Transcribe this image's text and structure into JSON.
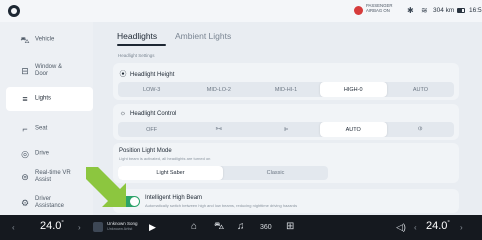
{
  "status": {
    "airbag_line1": "PASSENGER",
    "airbag_line2": "AIRBAG ON",
    "bluetooth_icon": "bluetooth-icon",
    "wifi_icon": "wifi-icon",
    "range": "304 km",
    "time": "16:53"
  },
  "sidebar": {
    "items": [
      {
        "label": "Vehicle",
        "icon": "car-icon"
      },
      {
        "label": "Window & Door",
        "icon": "door-icon"
      },
      {
        "label": "Lights",
        "icon": "lights-icon",
        "active": true
      },
      {
        "label": "Seat",
        "icon": "seat-icon"
      },
      {
        "label": "Drive",
        "icon": "steering-icon"
      },
      {
        "label": "Real-time VR Assist",
        "icon": "vr-icon"
      },
      {
        "label": "Driver Assistance",
        "icon": "driver-assist-icon"
      }
    ]
  },
  "tabs": [
    {
      "label": "Headlights",
      "active": true
    },
    {
      "label": "Ambient Lights",
      "active": false
    }
  ],
  "headlight_settings_label": "Headlight Settings",
  "headlight_height": {
    "title": "Headlight Height",
    "options": [
      "LOW-3",
      "MID-LO-2",
      "MID-HI-1",
      "HIGH-0",
      "AUTO"
    ],
    "selected": "HIGH-0"
  },
  "headlight_control": {
    "title": "Headlight Control",
    "options": [
      "OFF",
      "ⓓⓓ",
      "ⓓ",
      "AUTO",
      "ⓓ"
    ],
    "selected": "AUTO"
  },
  "position_light_mode": {
    "title": "Position Light Mode",
    "subtitle": "Light beam is activated, all headlights are turned on",
    "options": [
      "Light Saber",
      "Classic"
    ],
    "selected": "Light Saber"
  },
  "intelligent_high_beam": {
    "title": "Intelligent High Beam",
    "subtitle": "Automatically switch between high and low beams, reducing nighttime driving hazards",
    "enabled": true
  },
  "dock": {
    "left_temp": "24.0",
    "right_temp": "24.0",
    "temp_unit": "°",
    "song": "Unknown Song",
    "artist": "Unknown Artist"
  },
  "colors": {
    "accent_green": "#2ca36a",
    "arrow_green": "#8cc63f",
    "airbag_red": "#d63b3b"
  }
}
